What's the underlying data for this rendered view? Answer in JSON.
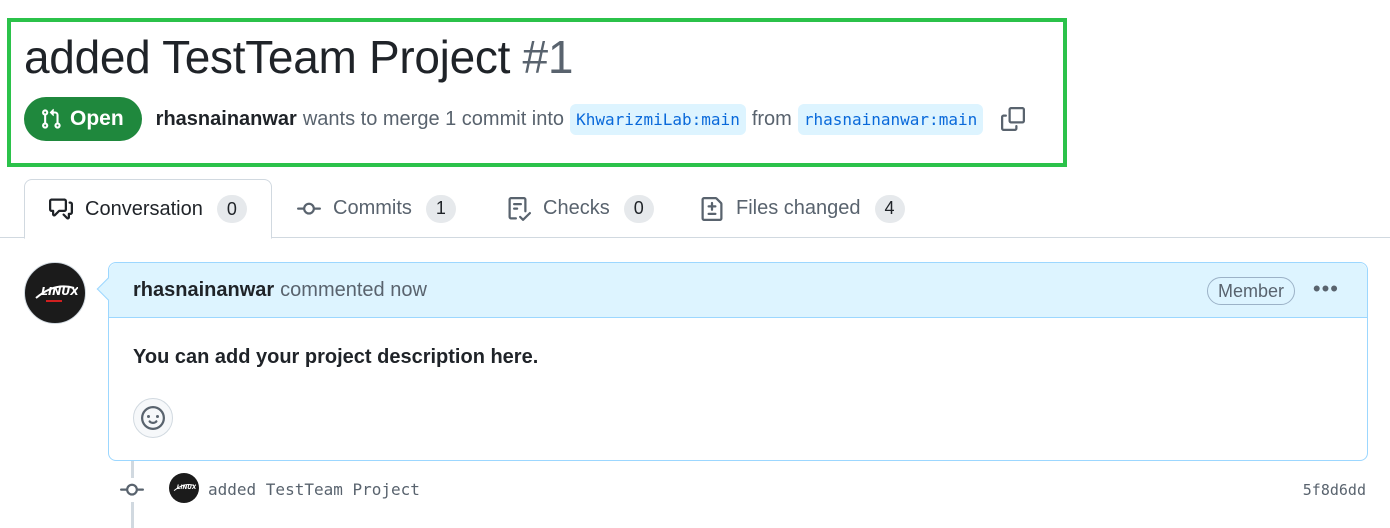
{
  "pr": {
    "title": "added TestTeam Project",
    "number": "#1",
    "state": "Open",
    "author": "rhasnainanwar",
    "merge_text": "wants to merge 1 commit into",
    "base_branch": "KhwarizmiLab:main",
    "from_text": "from",
    "head_branch": "rhasnainanwar:main"
  },
  "tabs": [
    {
      "label": "Conversation",
      "count": "0",
      "icon": "comment-discussion-icon"
    },
    {
      "label": "Commits",
      "count": "1",
      "icon": "git-commit-icon"
    },
    {
      "label": "Checks",
      "count": "0",
      "icon": "checklist-icon"
    },
    {
      "label": "Files changed",
      "count": "4",
      "icon": "file-diff-icon"
    }
  ],
  "comment": {
    "author": "rhasnainanwar",
    "action": "commented now",
    "role": "Member",
    "body": "You can add your project description here."
  },
  "commit": {
    "message": "added TestTeam Project",
    "sha": "5f8d6dd"
  },
  "colors": {
    "open_badge": "#1f883d",
    "highlight_border": "#2bc24a",
    "branch_bg": "#ddf4ff",
    "branch_text": "#0969da"
  }
}
